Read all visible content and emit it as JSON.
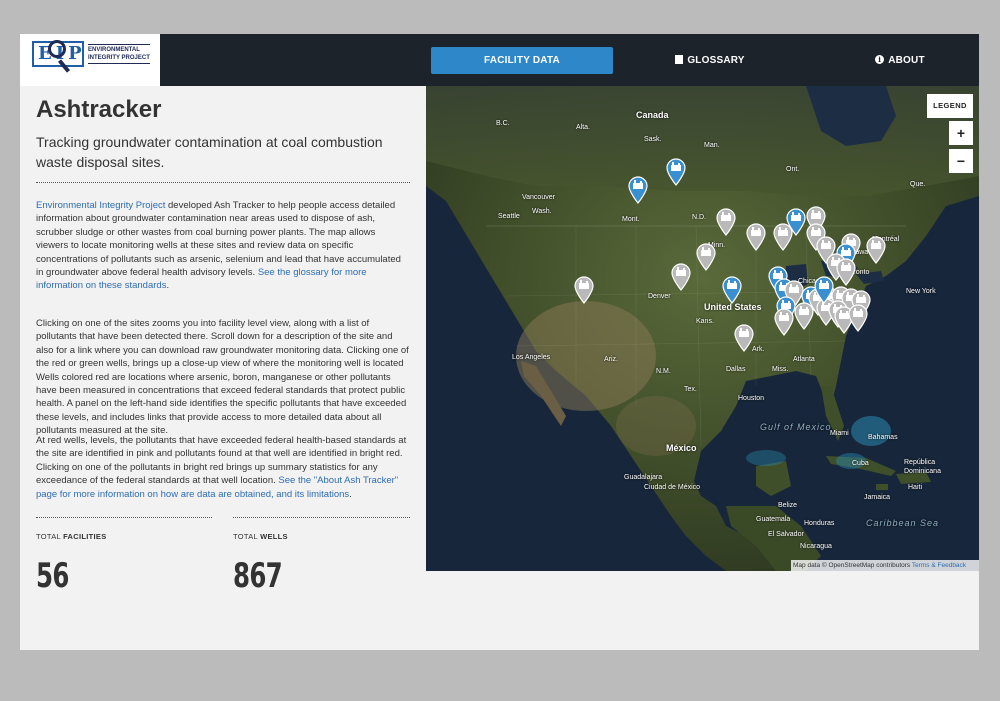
{
  "logo": {
    "text_line1": "ENVIRONMENTAL",
    "text_line2": "INTEGRITY PROJECT",
    "mark": "EIP"
  },
  "nav": {
    "facility_label": "FACILITY DATA",
    "glossary_label": "GLOSSARY",
    "glossary_icon": "book-icon",
    "about_label": "ABOUT",
    "about_icon": "info-icon",
    "active_color": "#2e87c8"
  },
  "page": {
    "title": "Ashtracker",
    "subtitle": "Tracking groundwater contamination at coal combustion waste disposal sites."
  },
  "para1": {
    "link1": "Environmental Integrity Project",
    "text1": " developed Ash Tracker to help people access detailed information about groundwater contamination near areas used to dispose of ash, scrubber sludge or other wastes from coal burning power plants. The map allows viewers to locate monitoring wells at these sites and review data on specific concentrations of pollutants such as arsenic, selenium and lead that have accumulated in groundwater above federal health advisory levels. ",
    "link2": "See the glossary for more information on these standards",
    "text2": "."
  },
  "para2": {
    "text": "Clicking on one of the sites zooms you into facility level view, along with a list of pollutants that have been detected there. Scroll down for a description of the site and also for a link where you can download raw groundwater monitoring data. Clicking one of the red or green wells, brings up a close-up view of where the monitoring well is located Wells colored red are locations where arsenic, boron, manganese or other pollutants have been measured in concentrations that exceed federal standards that protect public health. A panel on the left-hand side identifies the specific pollutants that have exceeded these levels, and includes links that provide access to more detailed data about all pollutants measured at the site."
  },
  "para3": {
    "text1": "At red wells, levels, the pollutants that have exceeded federal health-based standards at the site are identified in pink and pollutants found at that well are identified in bright red. Clicking on one of the pollutants in bright red brings up summary statistics for any exceedance of the federal standards at that well location. ",
    "link1": "See the \"About Ash Tracker\" page for more information on how are data are obtained, and its limitations",
    "text2": "."
  },
  "stats": {
    "facilities_label_prefix": "TOTAL ",
    "facilities_label_bold": "FACILITIES",
    "facilities_value": "56",
    "wells_label_prefix": "TOTAL ",
    "wells_label_bold": "WELLS",
    "wells_value": "867"
  },
  "map": {
    "legend_label": "LEGEND",
    "zoom_in": "+",
    "zoom_out": "−",
    "attribution_text": "Map data © OpenStreetMap contributors ",
    "attribution_link": "Terms & Feedback",
    "labels": {
      "canada": "Canada",
      "bc": "B.C.",
      "alta": "Alta.",
      "sask": "Sask.",
      "man": "Man.",
      "ont": "Ont.",
      "que": "Que.",
      "vancouver": "Vancouver",
      "seattle": "Seattle",
      "wash": "Wash.",
      "mont": "Mont.",
      "nd": "N.D.",
      "minn": "Minn.",
      "montreal": "Montréal",
      "ottawa": "Ottawa",
      "toronto": "Toronto",
      "chicago": "Chicago",
      "new_york": "New York",
      "denver": "Denver",
      "united_states": "United States",
      "kans": "Kans.",
      "los_angeles": "Los Angeles",
      "ariz": "Ariz.",
      "nm": "N.M.",
      "ark": "Ark.",
      "miss": "Miss.",
      "atlanta": "Atlanta",
      "dallas": "Dallas",
      "tex": "Tex.",
      "houston": "Houston",
      "miami": "Miami",
      "gulf_of_mexico": "Gulf of Mexico",
      "mexico": "México",
      "guadalajara": "Guadalajara",
      "ciudad_mexico": "Ciudad de México",
      "bahamas": "Bahamas",
      "cuba": "Cuba",
      "republica": "República Dominicana",
      "haiti": "Haiti",
      "jamaica": "Jamaica",
      "belize": "Belize",
      "guatemala": "Guatemala",
      "honduras": "Honduras",
      "el_salvador": "El Salvador",
      "nicaragua": "Nicaragua",
      "caribbean_sea": "Caribbean Sea"
    },
    "pin_colors": {
      "blue": "#3a8fd1",
      "gray": "#b9b9b9"
    },
    "pins": [
      {
        "color": "blue"
      },
      {
        "color": "blue"
      },
      {
        "color": "gray"
      },
      {
        "color": "gray"
      },
      {
        "color": "gray"
      },
      {
        "color": "gray"
      },
      {
        "color": "blue"
      },
      {
        "color": "gray"
      },
      {
        "color": "gray"
      },
      {
        "color": "gray"
      },
      {
        "color": "gray"
      },
      {
        "color": "blue"
      },
      {
        "color": "gray"
      },
      {
        "color": "gray"
      },
      {
        "color": "gray"
      },
      {
        "color": "blue"
      },
      {
        "color": "gray"
      },
      {
        "color": "gray"
      },
      {
        "color": "blue"
      },
      {
        "color": "blue"
      },
      {
        "color": "gray"
      },
      {
        "color": "blue"
      },
      {
        "color": "gray"
      },
      {
        "color": "gray"
      },
      {
        "color": "gray"
      },
      {
        "color": "gray"
      },
      {
        "color": "gray"
      },
      {
        "color": "gray"
      },
      {
        "color": "gray"
      },
      {
        "color": "blue"
      },
      {
        "color": "gray"
      },
      {
        "color": "gray"
      },
      {
        "color": "gray"
      },
      {
        "color": "blue"
      },
      {
        "color": "gray"
      },
      {
        "color": "gray"
      }
    ]
  }
}
